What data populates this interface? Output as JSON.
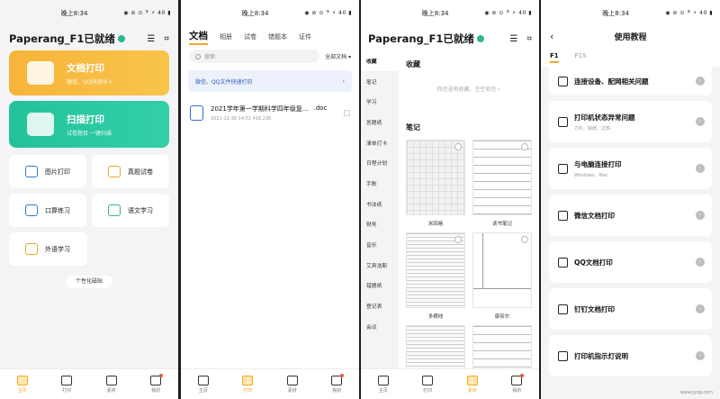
{
  "status": {
    "time": "晚上8:34",
    "icons": "◉ ⊘ ⊙ 𝄢 ⚡ 40 ▮"
  },
  "tabbar": {
    "home": "主页",
    "print": "打印",
    "material": "素材",
    "mine": "我的"
  },
  "home": {
    "title": "Paperang_F1已就绪",
    "doc_print": {
      "title": "文档打印",
      "subtitle": "微信、QQ快速导入"
    },
    "scan_print": {
      "title": "扫描打印",
      "subtitle": "试卷题目 一键扫描"
    },
    "tools": [
      "图片打印",
      "真题试卷",
      "口算练习",
      "语文学习"
    ],
    "extra_tool": "外语学习",
    "custom_sticker": "个性化磁贴"
  },
  "docs": {
    "tabs": [
      "文档",
      "相册",
      "试卷",
      "错题本",
      "证件"
    ],
    "search_placeholder": "搜索",
    "all_docs": "全部文档 ▾",
    "banner": "微信、QQ文件快速打印",
    "banner_arrow": "›",
    "file": {
      "name": "2021学年第一学期科学四年级复...",
      "ext": ".doc",
      "meta": "2021-12-30 14:52  416.23K"
    }
  },
  "material": {
    "title": "Paperang_F1已就绪",
    "side": [
      "收藏",
      "笔记",
      "学习",
      "答题纸",
      "清单打卡",
      "日程计划",
      "手账",
      "书法纸",
      "财务",
      "音乐",
      "艾宾浩斯",
      "错题纸",
      "登记表",
      "会议"
    ],
    "favorites_label": "收藏",
    "empty": "你还没有收藏，空空如也~",
    "notes_label": "笔记",
    "papers": [
      "米回格",
      "读书笔记",
      "多横线",
      "康奈尔"
    ]
  },
  "tutorial": {
    "title": "使用教程",
    "back": "‹",
    "tabs": [
      "F1",
      "F1S"
    ],
    "items": [
      {
        "title": "连接设备、配网相关问题",
        "sub": ""
      },
      {
        "title": "打印机状态异常问题",
        "sub": "刀片、缺纸、过热"
      },
      {
        "title": "与电脑连接打印",
        "sub": "Windows、Mac"
      },
      {
        "title": "微信文档打印",
        "sub": ""
      },
      {
        "title": "QQ文档打印",
        "sub": ""
      },
      {
        "title": "钉钉文档打印",
        "sub": ""
      },
      {
        "title": "打印机指示灯说明",
        "sub": ""
      }
    ],
    "watermark": "www.jyxg.com"
  },
  "colors": {
    "accent": "#f0a822",
    "orange_card": "#f7b43a",
    "green_card": "#23c29b",
    "link_blue": "#3660b8"
  }
}
